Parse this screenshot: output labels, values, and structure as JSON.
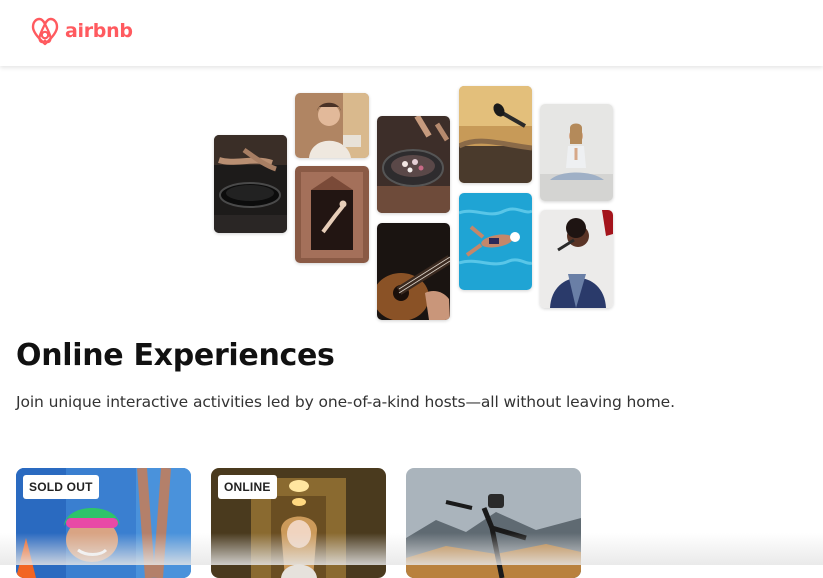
{
  "header": {
    "logo_text": "airbnb",
    "logo_icon": "airbnb-belo-icon",
    "brand_color": "#FF5A5F"
  },
  "hero": {
    "photos": [
      {
        "name": "cooking-pan-photo"
      },
      {
        "name": "host-portrait-photo"
      },
      {
        "name": "dancer-doorway-photo"
      },
      {
        "name": "food-bowl-photo"
      },
      {
        "name": "guitar-photo"
      },
      {
        "name": "dj-microphone-photo"
      },
      {
        "name": "swimmer-pool-photo"
      },
      {
        "name": "yoga-photo"
      },
      {
        "name": "singer-photo"
      }
    ]
  },
  "main": {
    "title": "Online Experiences",
    "subtitle": "Join unique interactive activities led by one-of-a-kind hosts—all without leaving home."
  },
  "cards": [
    {
      "badge": "SOLD OUT",
      "image": "swimmer-goggles-photo"
    },
    {
      "badge": "ONLINE",
      "image": "woman-hallway-photo"
    },
    {
      "badge": "",
      "image": "bicycle-mountains-photo"
    }
  ]
}
